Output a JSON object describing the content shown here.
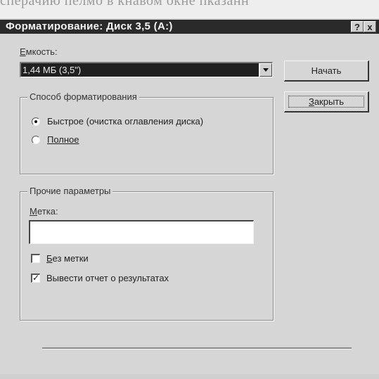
{
  "background_text": "сперачию пелмо в кнавом окне пказанн",
  "window": {
    "title": "Форматирование: Диск 3,5 (А:)",
    "help_button": "?",
    "close_button": "x"
  },
  "capacity": {
    "label_first": "Е",
    "label_rest": "мкость:",
    "selected_value": "1,44 МБ (3,5\")"
  },
  "buttons": {
    "start": "Начать",
    "close_first": "З",
    "close_rest": "акрыть"
  },
  "format_type": {
    "title": "Способ форматирования",
    "options": [
      {
        "label": "Быстрое (очистка оглавления диска)",
        "selected": true
      },
      {
        "label": "Полное",
        "selected": false
      }
    ]
  },
  "other_options": {
    "title": "Прочие параметры",
    "label_field_first": "М",
    "label_field_rest": "етка:",
    "label_value": "",
    "checkboxes": [
      {
        "label_first": "Б",
        "label_rest": "ез метки",
        "checked": false
      },
      {
        "label_first": "",
        "label_rest": "Вывести отчет о результатах",
        "checked": true
      }
    ]
  }
}
